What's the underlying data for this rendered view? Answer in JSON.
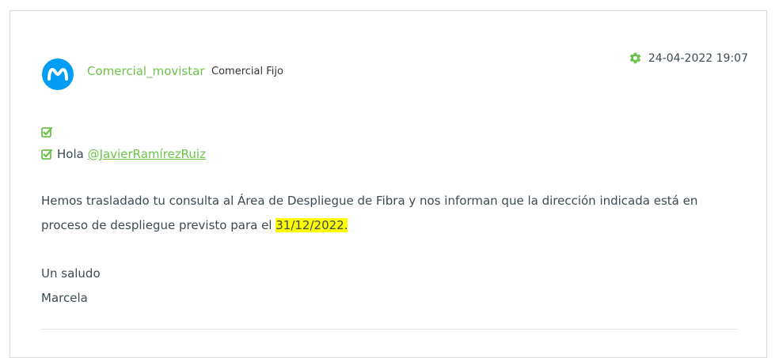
{
  "post": {
    "author_name": "Comercial_movistar",
    "author_rank": "Comercial Fijo",
    "timestamp": "24-04-2022 19:07",
    "hello_prefix": "Hola ",
    "mention": "@JavierRamírezRuiz",
    "paragraph_text": "Hemos trasladado tu consulta al Área de Despliegue de Fibra y nos informan que la dirección indicada está en proceso de despliegue previsto para el ",
    "highlighted_date": "31/12/2022.",
    "closing_line_1": "Un saludo",
    "closing_line_2": "Marcela"
  },
  "icons": {
    "avatar": "movistar-logo-icon",
    "timestamp": "gear-icon",
    "checks": "check-square-icon"
  },
  "colors": {
    "brand_green": "#6cc24a",
    "avatar_blue": "#019df4",
    "highlight": "#ffff00",
    "text": "#3c4a52"
  }
}
